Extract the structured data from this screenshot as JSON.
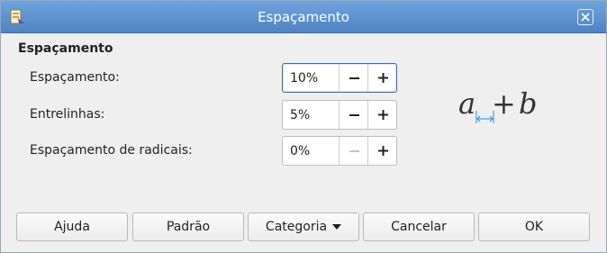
{
  "window": {
    "title": "Espaçamento"
  },
  "section": {
    "title": "Espaçamento"
  },
  "rows": [
    {
      "label": "Espaçamento:",
      "value": "10%",
      "focused": true,
      "minus_enabled": true
    },
    {
      "label": "Entrelinhas:",
      "value": "5%",
      "focused": false,
      "minus_enabled": true
    },
    {
      "label": "Espaçamento de radicais:",
      "value": "0%",
      "focused": false,
      "minus_enabled": false
    }
  ],
  "preview": {
    "left": "a",
    "operator": "+",
    "right": "b"
  },
  "buttons": {
    "help": "Ajuda",
    "default": "Padrão",
    "category": "Categoria",
    "cancel": "Cancelar",
    "ok": "OK"
  },
  "colors": {
    "titlebar": "#5b90d0",
    "accent": "#3d6aa8",
    "dimension": "#2a8fd6"
  },
  "icons": {
    "app": "app-icon",
    "close": "close-icon",
    "minus": "minus-icon",
    "plus": "plus-icon",
    "dropdown": "dropdown-arrow-icon"
  }
}
